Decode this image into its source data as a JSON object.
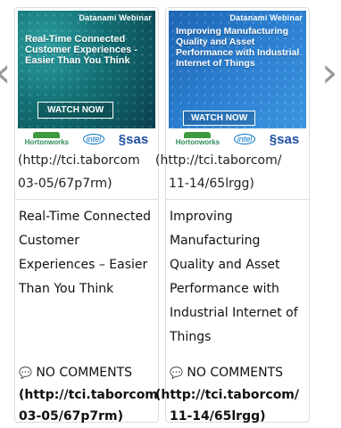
{
  "nav": {
    "prev": "‹",
    "next": "›"
  },
  "cards": [
    {
      "banner": {
        "brand": "Datanami Webinar",
        "title": "Real-Time Connected Customer Experiences - Easier Than You Think",
        "button": "WATCH NOW",
        "logos": [
          "Hortonworks",
          "intel",
          "sas"
        ],
        "background": "#126f73"
      },
      "url_line1": "(http://tci.taborcom",
      "url_line2": "03-05/67p7rm)",
      "title": "Real-Time Connected Customer Experiences – Easier Than You Think",
      "comments": "NO COMMENTS",
      "comment_icon": "comment-icon",
      "link_line1": "(http://tci.taborcom",
      "link_line2": "03-05/67p7rm)"
    },
    {
      "banner": {
        "brand": "Datanami Webinar",
        "title": "Improving Manufacturing Quality and Asset Performance with Industrial Internet of Things",
        "button": "WATCH NOW",
        "logos": [
          "Hortonworks",
          "intel",
          "sas"
        ],
        "background": "#2b7fd0"
      },
      "url_line1": "(http://tci.taborcom/",
      "url_line2": "11-14/65lrgg)",
      "title": "Improving Manufacturing Quality and Asset Performance with Industrial Internet of Things",
      "comments": "NO COMMENTS",
      "comment_icon": "comment-icon",
      "link_line1": "(http://tci.taborcom/",
      "link_line2": "11-14/65lrgg)"
    }
  ]
}
